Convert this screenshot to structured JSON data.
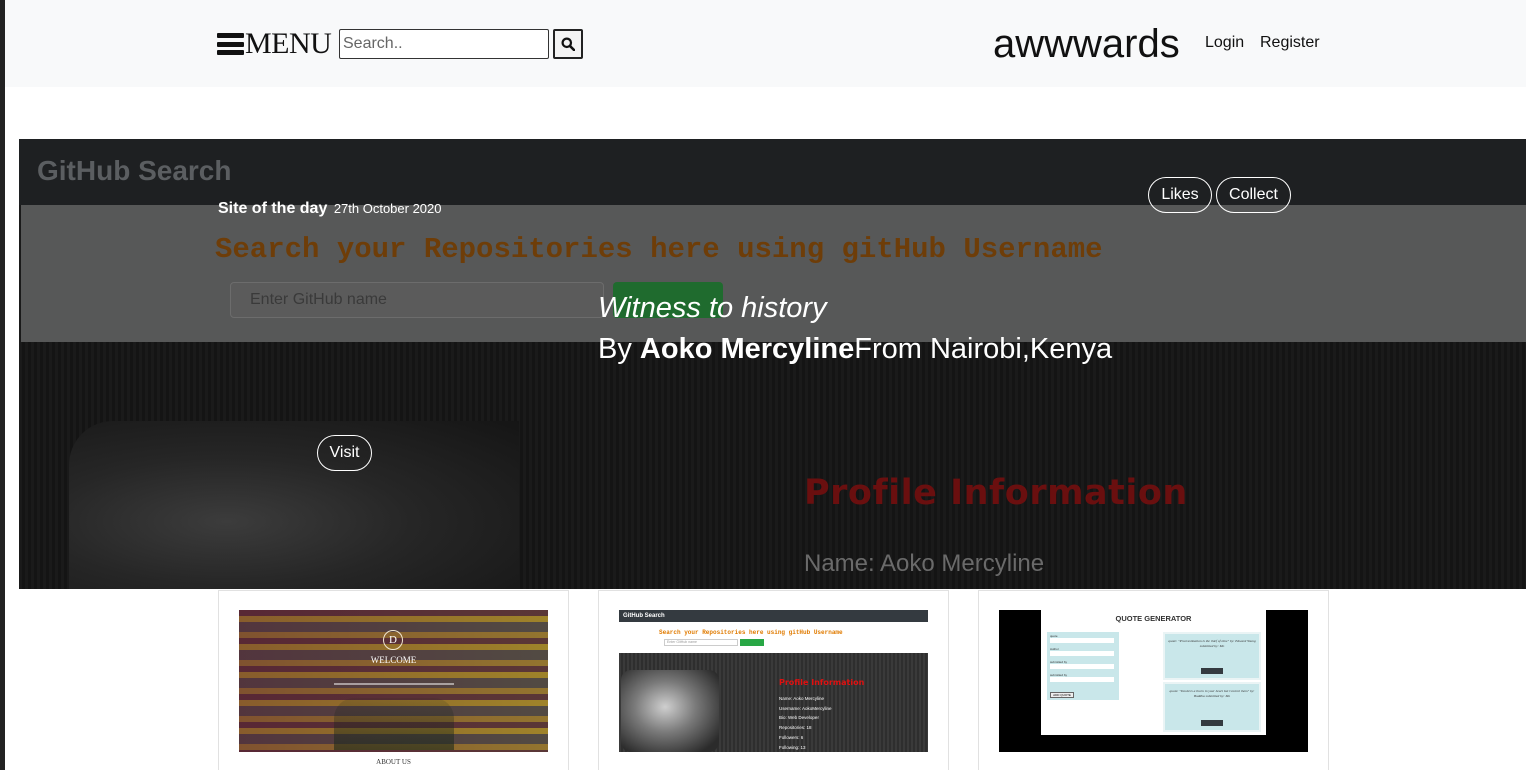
{
  "navbar": {
    "menu_label": "MENU",
    "search_placeholder": "Search..",
    "brand": "awwwards",
    "login": "Login",
    "register": "Register"
  },
  "hero": {
    "site_of_day_label": "Site of the day",
    "date": "27th October 2020",
    "likes": "Likes",
    "collect": "Collect",
    "visit": "Visit",
    "title": "Witness to history",
    "by_prefix": "By ",
    "author": "Aoko Mercyline",
    "from": "From Nairobi,Kenya",
    "screenshot": {
      "app_title": "GitHub Search",
      "heading": "Search your Repositories here using gitHub Username",
      "input_placeholder": "Enter GitHub name",
      "section_title": "Profile Information",
      "name_line": "Name: Aoko Mercyline"
    }
  },
  "cards": [
    {
      "logo_letter": "D",
      "welcome": "WELCOME",
      "caption": "ABOUT US"
    },
    {
      "top_title": "GitHub Search",
      "heading": "Search your Repositories here using gitHub Username",
      "input_placeholder": "Enter GitHub name",
      "profile_title": "Profile Information",
      "info_lines": [
        "Name: Aoko Mercyline",
        "Username: AokoMercyline",
        "Bio: Web Developer",
        "Repositories: 18",
        "Followers: 6",
        "Following: 13"
      ]
    },
    {
      "title": "QUOTE GENERATOR",
      "form_labels": [
        "quote",
        "Author",
        "submitted by",
        "submitted by"
      ],
      "add_button": "ADD QUOTE",
      "quotes": [
        "quote: \"Procrastination is the thief of time\" by: Edward Young submitted by: Mo",
        "quote: \"Doubt is a thorn in your heart but Control them\" by: Buddha submitted by: Mo"
      ]
    }
  ],
  "colors": {
    "navbar_bg": "#f8f9fa",
    "hero_bg": "#131313",
    "accent_orange": "#6e3d08",
    "profile_red": "#e01010"
  },
  "icons": {
    "menu": "hamburger-icon",
    "search": "search-icon"
  }
}
